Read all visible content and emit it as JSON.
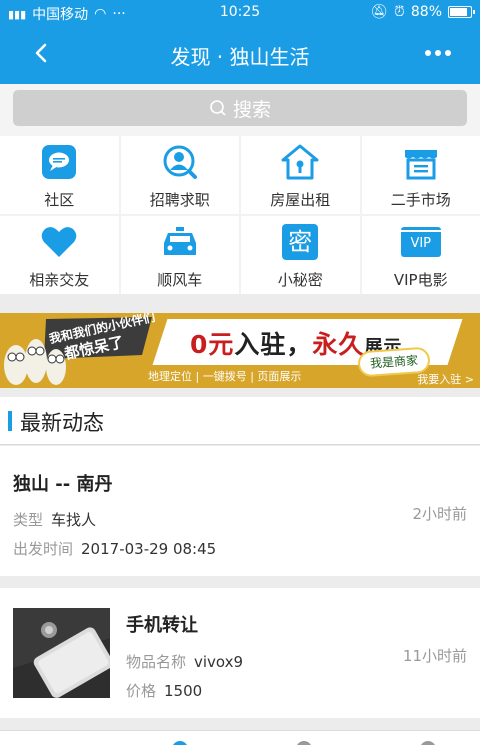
{
  "status_bar": {
    "carrier": "中国移动",
    "time": "10:25",
    "battery": "88%",
    "battery_level": 0.88
  },
  "nav": {
    "title": "发现 · 独山生活"
  },
  "search": {
    "label": "搜索"
  },
  "categories": [
    {
      "label": "社区",
      "icon": "chat-bubble-icon"
    },
    {
      "label": "招聘求职",
      "icon": "person-search-icon"
    },
    {
      "label": "房屋出租",
      "icon": "house-icon"
    },
    {
      "label": "二手市场",
      "icon": "shop-icon"
    },
    {
      "label": "相亲交友",
      "icon": "heart-icon"
    },
    {
      "label": "顺风车",
      "icon": "car-icon"
    },
    {
      "label": "小秘密",
      "icon": "secret-icon",
      "glyph": "密"
    },
    {
      "label": "VIP电影",
      "icon": "vip-ticket-icon",
      "glyph": "VIP"
    }
  ],
  "banner": {
    "bubble_line1": "我和我们的小伙伴们",
    "bubble_line2": "都惊呆了",
    "headline_a": "0元",
    "headline_b": "入驻，",
    "headline_c": "永久",
    "headline_d": "展示",
    "merchant": "我是商家",
    "features": "地理定位 | 一键拨号 | 页面展示",
    "join": "我要入驻 >"
  },
  "section": {
    "title": "最新动态"
  },
  "posts": [
    {
      "title": "独山 -- 南丹",
      "fields": [
        {
          "key": "类型",
          "value": "车找人"
        },
        {
          "key": "出发时间",
          "value": "2017-03-29 08:45"
        }
      ],
      "ago": "2小时前"
    },
    {
      "title": "手机转让",
      "fields": [
        {
          "key": "物品名称",
          "value": "vivox9"
        },
        {
          "key": "价格",
          "value": "1500"
        }
      ],
      "ago": "11小时前"
    }
  ],
  "colors": {
    "brand": "#1b9de6",
    "banner": "#d6a52a"
  }
}
